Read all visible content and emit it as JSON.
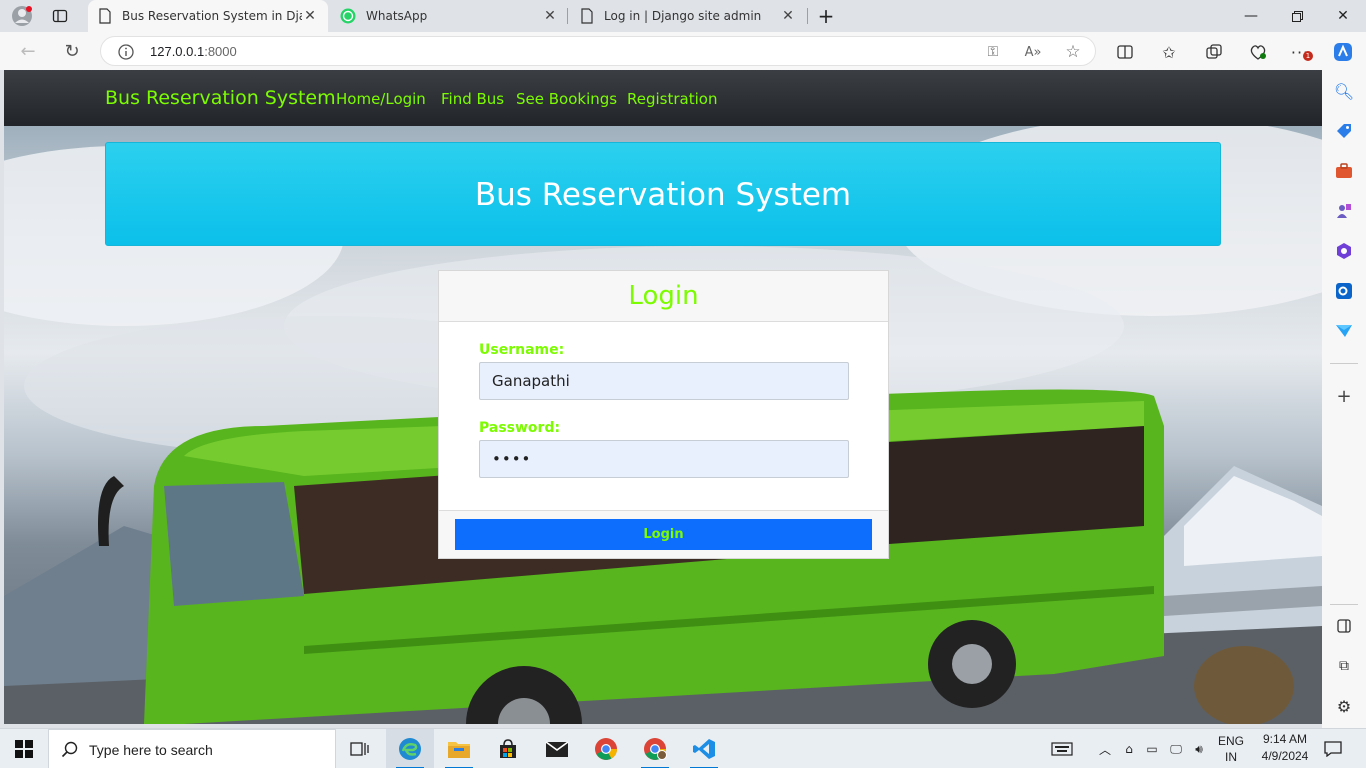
{
  "browser": {
    "tabs": [
      {
        "title": "Bus Reservation System in Django",
        "active": true,
        "icon": "page-icon"
      },
      {
        "title": "WhatsApp",
        "active": false,
        "icon": "whatsapp-icon"
      },
      {
        "title": "Log in | Django site admin",
        "active": false,
        "icon": "page-icon"
      }
    ],
    "url_host": "127.0.0.1",
    "url_port": ":8000",
    "accent_color": "#0078d4"
  },
  "site": {
    "brand": "Bus Reservation System",
    "nav_links": [
      "Home/Login",
      "Find Bus",
      "See Bookings",
      "Registration"
    ],
    "banner_title": "Bus Reservation System",
    "text_color": "#7cfc00",
    "banner_color": "#0dcaf0",
    "button_color": "#0d6efd"
  },
  "login_form": {
    "title": "Login",
    "username_label": "Username:",
    "username_value": "Ganapathi",
    "password_label": "Password:",
    "password_value": "••••",
    "submit_label": "Login"
  },
  "taskbar": {
    "search_placeholder": "Type here to search",
    "language_line1": "ENG",
    "language_line2": "IN",
    "time": "9:14 AM",
    "date": "4/9/2024"
  }
}
